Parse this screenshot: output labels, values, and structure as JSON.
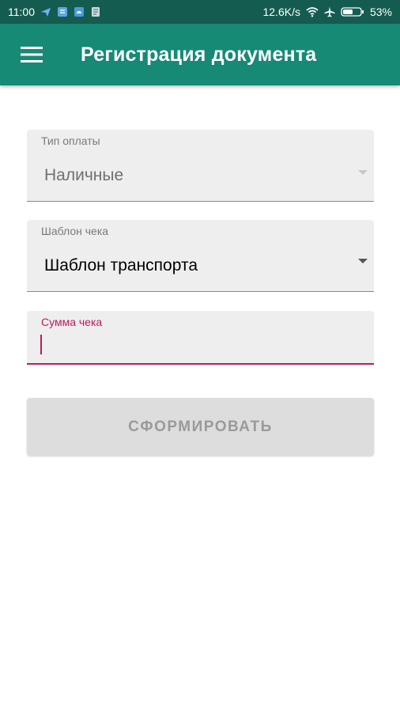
{
  "status_bar": {
    "time": "11:00",
    "speed": "12.6K/s",
    "battery": "53%",
    "icons": [
      "plane-notification-icon",
      "app-notification-icon",
      "cloud-notification-icon",
      "doc-notification-icon",
      "wifi-icon",
      "airplane-mode-icon",
      "battery-icon"
    ]
  },
  "app_bar": {
    "title": "Регистрация документа",
    "menu_icon": "hamburger-menu-icon"
  },
  "form": {
    "payment_type": {
      "label": "Тип оплаты",
      "value": "Наличные"
    },
    "receipt_template": {
      "label": "Шаблон чека",
      "value": "Шаблон транспорта"
    },
    "receipt_amount": {
      "label": "Сумма чека",
      "value": ""
    },
    "submit_label": "СФОРМИРОВАТЬ"
  },
  "colors": {
    "status_bar": "#155c50",
    "app_bar": "#178a76",
    "accent": "#c2185b",
    "field_bg": "#eeeeee",
    "button_disabled_bg": "#dddddd"
  }
}
